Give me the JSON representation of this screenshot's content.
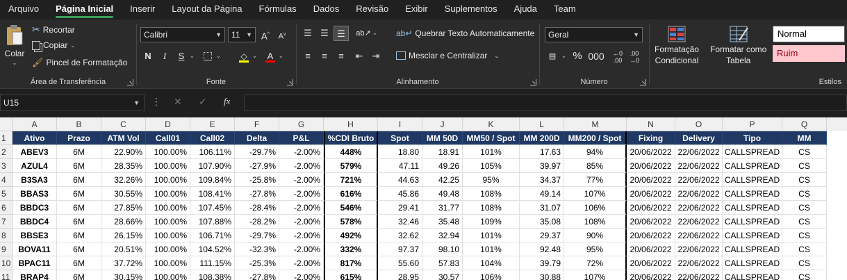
{
  "menu": [
    "Arquivo",
    "Página Inicial",
    "Inserir",
    "Layout da Página",
    "Fórmulas",
    "Dados",
    "Revisão",
    "Exibir",
    "Suplementos",
    "Ajuda",
    "Team"
  ],
  "ribbon": {
    "clipboard": {
      "paste": "Colar",
      "cut": "Recortar",
      "copy": "Copiar",
      "format_painter": "Pincel de Formatação",
      "label": "Área de Transferência"
    },
    "font": {
      "name": "Calibri",
      "size": "11",
      "bold": "N",
      "italic": "I",
      "underline": "S",
      "label": "Fonte"
    },
    "alignment": {
      "wrap": "Quebrar Texto Automaticamente",
      "merge": "Mesclar e Centralizar",
      "label": "Alinhamento"
    },
    "number": {
      "format": "Geral",
      "percent": "%",
      "thousands": "000",
      "label": "Número"
    },
    "styles": {
      "conditional_1": "Formatação",
      "conditional_2": "Condicional",
      "table_1": "Formatar como",
      "table_2": "Tabela",
      "normal": "Normal",
      "bad": "Ruim",
      "label": "Estilos"
    }
  },
  "formula_bar": {
    "name_box": "U15",
    "fx": "fx",
    "value": ""
  },
  "columns": [
    "A",
    "B",
    "C",
    "D",
    "E",
    "F",
    "G",
    "H",
    "I",
    "J",
    "K",
    "L",
    "M",
    "N",
    "O",
    "P",
    "Q"
  ],
  "table": {
    "headers": [
      "Ativo",
      "Prazo",
      "ATM Vol",
      "Call01",
      "Call02",
      "Delta",
      "P&L",
      "%CDI Bruto",
      "Spot",
      "MM 50D",
      "MM50 / Spot",
      "MM 200D",
      "MM200 / Spot",
      "Fixing",
      "Delivery",
      "Tipo",
      "MM"
    ],
    "rows": [
      [
        "ABEV3",
        "6M",
        "22.90%",
        "100.00%",
        "106.11%",
        "-29.7%",
        "-2.00%",
        "448%",
        "18.80",
        "18.91",
        "101%",
        "17.63",
        "94%",
        "20/06/2022",
        "22/06/2022",
        "CALLSPREAD",
        "CS"
      ],
      [
        "AZUL4",
        "6M",
        "28.35%",
        "100.00%",
        "107.90%",
        "-27.9%",
        "-2.00%",
        "579%",
        "47.11",
        "49.26",
        "105%",
        "39.97",
        "85%",
        "20/06/2022",
        "22/06/2022",
        "CALLSPREAD",
        "CS"
      ],
      [
        "B3SA3",
        "6M",
        "32.26%",
        "100.00%",
        "109.84%",
        "-25.8%",
        "-2.00%",
        "721%",
        "44.63",
        "42.25",
        "95%",
        "34.37",
        "77%",
        "20/06/2022",
        "22/06/2022",
        "CALLSPREAD",
        "CS"
      ],
      [
        "BBAS3",
        "6M",
        "30.55%",
        "100.00%",
        "108.41%",
        "-27.8%",
        "-2.00%",
        "616%",
        "45.86",
        "49.48",
        "108%",
        "49.14",
        "107%",
        "20/06/2022",
        "22/06/2022",
        "CALLSPREAD",
        "CS"
      ],
      [
        "BBDC3",
        "6M",
        "27.85%",
        "100.00%",
        "107.45%",
        "-28.4%",
        "-2.00%",
        "546%",
        "29.41",
        "31.77",
        "108%",
        "31.07",
        "106%",
        "20/06/2022",
        "22/06/2022",
        "CALLSPREAD",
        "CS"
      ],
      [
        "BBDC4",
        "6M",
        "28.66%",
        "100.00%",
        "107.88%",
        "-28.2%",
        "-2.00%",
        "578%",
        "32.46",
        "35.48",
        "109%",
        "35.08",
        "108%",
        "20/06/2022",
        "22/06/2022",
        "CALLSPREAD",
        "CS"
      ],
      [
        "BBSE3",
        "6M",
        "26.15%",
        "100.00%",
        "106.71%",
        "-29.7%",
        "-2.00%",
        "492%",
        "32.62",
        "32.94",
        "101%",
        "29.37",
        "90%",
        "20/06/2022",
        "22/06/2022",
        "CALLSPREAD",
        "CS"
      ],
      [
        "BOVA11",
        "6M",
        "20.51%",
        "100.00%",
        "104.52%",
        "-32.3%",
        "-2.00%",
        "332%",
        "97.37",
        "98.10",
        "101%",
        "92.48",
        "95%",
        "20/06/2022",
        "22/06/2022",
        "CALLSPREAD",
        "CS"
      ],
      [
        "BPAC11",
        "6M",
        "37.72%",
        "100.00%",
        "111.15%",
        "-25.3%",
        "-2.00%",
        "817%",
        "55.60",
        "57.83",
        "104%",
        "39.79",
        "72%",
        "20/06/2022",
        "22/06/2022",
        "CALLSPREAD",
        "CS"
      ],
      [
        "BRAP4",
        "6M",
        "30.15%",
        "100.00%",
        "108.38%",
        "-27.8%",
        "-2.00%",
        "615%",
        "28.95",
        "30.57",
        "106%",
        "30.88",
        "107%",
        "20/06/2022",
        "22/06/2022",
        "CALLSPREAD",
        "CS"
      ]
    ]
  },
  "colors": {
    "header_fill": "#1f3864",
    "accent": "#3b9e5a",
    "bad_fill": "#ffc7ce",
    "bad_text": "#9c0006"
  }
}
